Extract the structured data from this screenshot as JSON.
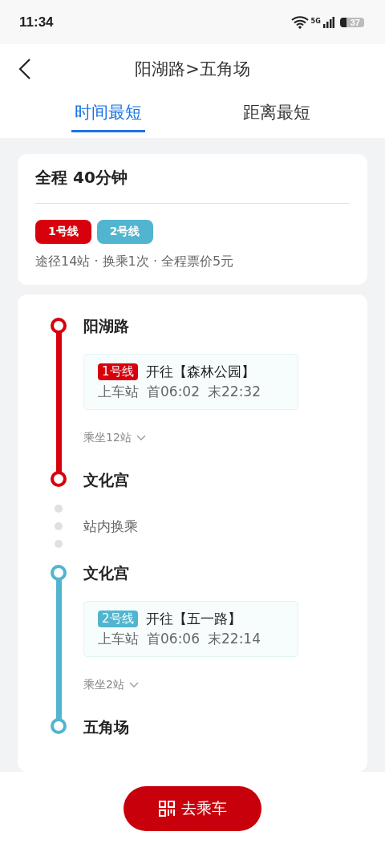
{
  "status_bar": {
    "time": "11:34",
    "network": "5G",
    "battery": "37"
  },
  "header": {
    "title": "阳湖路>五角场"
  },
  "tabs": [
    {
      "label": "时间最短",
      "selected": true
    },
    {
      "label": "距离最短",
      "selected": false
    }
  ],
  "summary": {
    "duration": "全程 40分钟",
    "lines": [
      {
        "name": "1号线",
        "color": "#d9000d"
      },
      {
        "name": "2号线",
        "color": "#52b5cf"
      }
    ],
    "info": "途径14站 · 换乘1次 · 全程票价5元"
  },
  "segments": [
    {
      "board_station": "阳湖路",
      "line_name": "1号线",
      "color": "#d9000d",
      "direction": "开往【森林公园】",
      "board_label": "上车站",
      "first": "首06:02",
      "last": "末22:32",
      "ride": "乘坐12站",
      "alight_station": "文化宫"
    },
    {
      "board_station": "文化宫",
      "line_name": "2号线",
      "color": "#52b5cf",
      "direction": "开往【五一路】",
      "board_label": "上车站",
      "first": "首06:06",
      "last": "末22:14",
      "ride": "乘坐2站",
      "alight_station": "五角场"
    }
  ],
  "transfer": "站内换乘",
  "go_button": {
    "label": "去乘车"
  }
}
